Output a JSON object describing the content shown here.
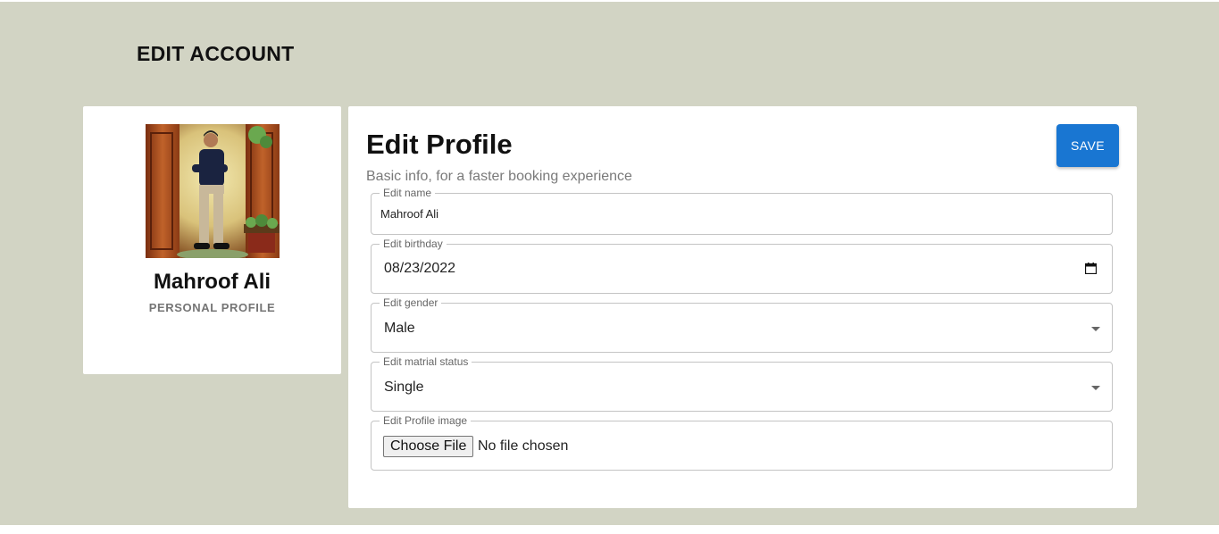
{
  "page": {
    "title": "EDIT ACCOUNT",
    "background_color": "#d2d4c4"
  },
  "profile": {
    "avatar_icon": "profile-photo",
    "name": "Mahroof Ali",
    "subtitle": "PERSONAL PROFILE"
  },
  "form": {
    "title": "Edit Profile",
    "subtitle": "Basic info, for a faster booking experience",
    "save_label": "SAVE",
    "accent_color": "#1976d2",
    "fields": {
      "name": {
        "label": "Edit name",
        "value": "Mahroof Ali"
      },
      "birthday": {
        "label": "Edit birthday",
        "value": "08/23/2022",
        "icon": "calendar-icon"
      },
      "gender": {
        "label": "Edit gender",
        "value": "Male",
        "icon": "chevron-down-icon"
      },
      "marital": {
        "label": "Edit matrial status",
        "value": "Single",
        "icon": "chevron-down-icon"
      },
      "image": {
        "label": "Edit Profile image",
        "button_label": "Choose File",
        "status": "No file chosen"
      }
    }
  }
}
